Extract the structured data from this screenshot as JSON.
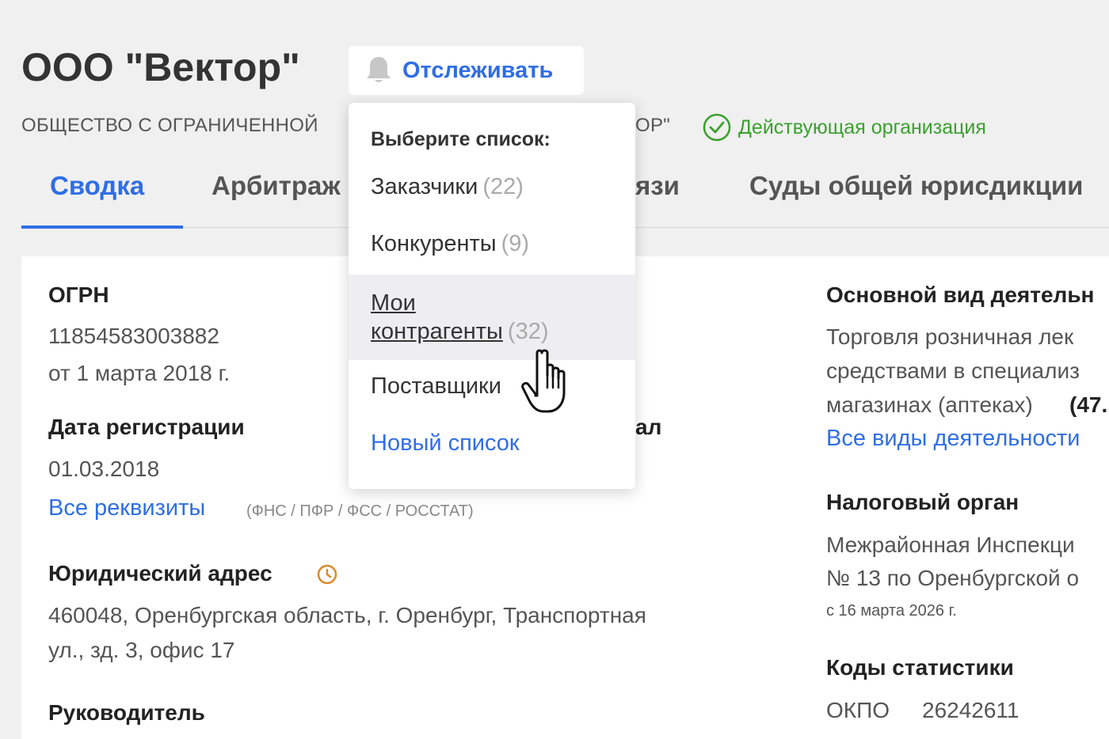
{
  "header": {
    "company_name": "ООО \"Вектор\"",
    "track_label": "Отслеживать",
    "legal_name_visible_left": "ОБЩЕСТВО С ОГРАНИЧЕННОЙ",
    "legal_name_visible_right": "ОР\"",
    "status_text": "Действующая организация"
  },
  "tabs": [
    {
      "label": "Сводка",
      "active": true
    },
    {
      "label": "Арбитраж"
    },
    {
      "label": "язи"
    },
    {
      "label": "Суды общей юрисдикции"
    }
  ],
  "left": {
    "ogrn_title": "ОГРН",
    "ogrn_value": "11854583003882",
    "ogrn_date": "от 1 марта 2018 г.",
    "reg_title": "Дата регистрации",
    "reg_value": "01.03.2018",
    "all_reqs_link": "Все реквизиты",
    "all_reqs_note": "(ФНС / ПФР / ФСС / РОССТАТ)",
    "address_title": "Юридический адрес",
    "address_line1": "460048, Оренбургская область, г. Оренбург, Транспортная",
    "address_line2": "ул., зд. 3, офис 17",
    "manager_title": "Руководитель"
  },
  "middle": {
    "partial_heading": "ал"
  },
  "right": {
    "activity_title": "Основной вид деятельн",
    "activity_line1": "Торговля розничная лек",
    "activity_line2": "средствами в специализ",
    "activity_line3": "магазинах (аптеках)",
    "activity_code": "(47.",
    "all_activities_link": "Все виды деятельности",
    "tax_title": "Налоговый орган",
    "tax_line1": "Межрайонная Инспекци",
    "tax_line2": "№ 13 по Оренбургской о",
    "tax_since": "с 16 марта 2026 г.",
    "stats_title": "Коды статистики",
    "okpo_label": "ОКПО",
    "okpo_value": "26242611"
  },
  "dropdown": {
    "title": "Выберите список:",
    "items": [
      {
        "name": "Заказчики",
        "count": "(22)"
      },
      {
        "name": "Конкуренты",
        "count": "(9)"
      },
      {
        "name_line1": "Мои",
        "name_line2": "контрагенты",
        "count": "(32)",
        "hovered": true
      },
      {
        "name": "Поставщики"
      }
    ],
    "new_list": "Новый список"
  },
  "colors": {
    "accent": "#2f6ee5",
    "status_green": "#3aa12e",
    "clock_orange": "#d98a2b"
  },
  "icons": [
    "bell-icon",
    "check-circle-icon",
    "clock-icon",
    "hand-pointer-cursor"
  ]
}
